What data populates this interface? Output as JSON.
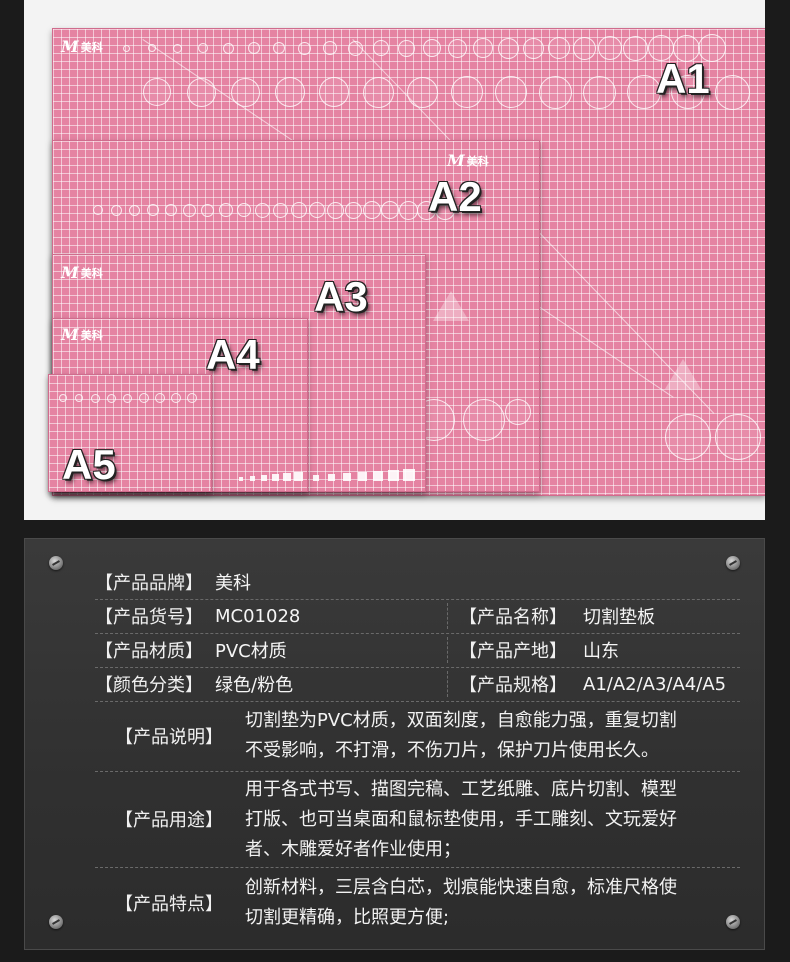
{
  "photo": {
    "labels": {
      "a1": "A1",
      "a2": "A2",
      "a3": "A3",
      "a4": "A4",
      "a5": "A5"
    },
    "brand_text": "美科",
    "brand_letter": "M",
    "colors": {
      "mat": "#e583a2",
      "background": "#f3f3f3"
    }
  },
  "specs": {
    "rows": [
      {
        "label": "【产品品牌】",
        "value": "美科"
      },
      {
        "label": "【产品货号】",
        "value": "MC01028",
        "label2": "【产品名称】",
        "value2": "切割垫板"
      },
      {
        "label": "【产品材质】",
        "value": "PVC材质",
        "label2": "【产品产地】",
        "value2": "山东"
      },
      {
        "label": "【颜色分类】",
        "value": "绿色/粉色",
        "label2": "【产品规格】",
        "value2": "A1/A2/A3/A4/A5"
      }
    ],
    "descriptions": [
      {
        "label": "【产品说明】",
        "lines": [
          "切割垫为PVC材质，双面刻度，自愈能力强，重复切割",
          "不受影响，不打滑，不伤刀片，保护刀片使用长久。"
        ]
      },
      {
        "label": "【产品用途】",
        "lines": [
          "用于各式书写、描图完稿、工艺纸雕、底片切割、模型",
          "打版、也可当桌面和鼠标垫使用，手工雕刻、文玩爱好",
          "者、木雕爱好者作业使用；"
        ]
      },
      {
        "label": "【产品特点】",
        "lines": [
          "创新材料，三层含白芯，划痕能快速自愈，标准尺格使",
          "切割更精确，比照更方便;"
        ]
      }
    ]
  }
}
